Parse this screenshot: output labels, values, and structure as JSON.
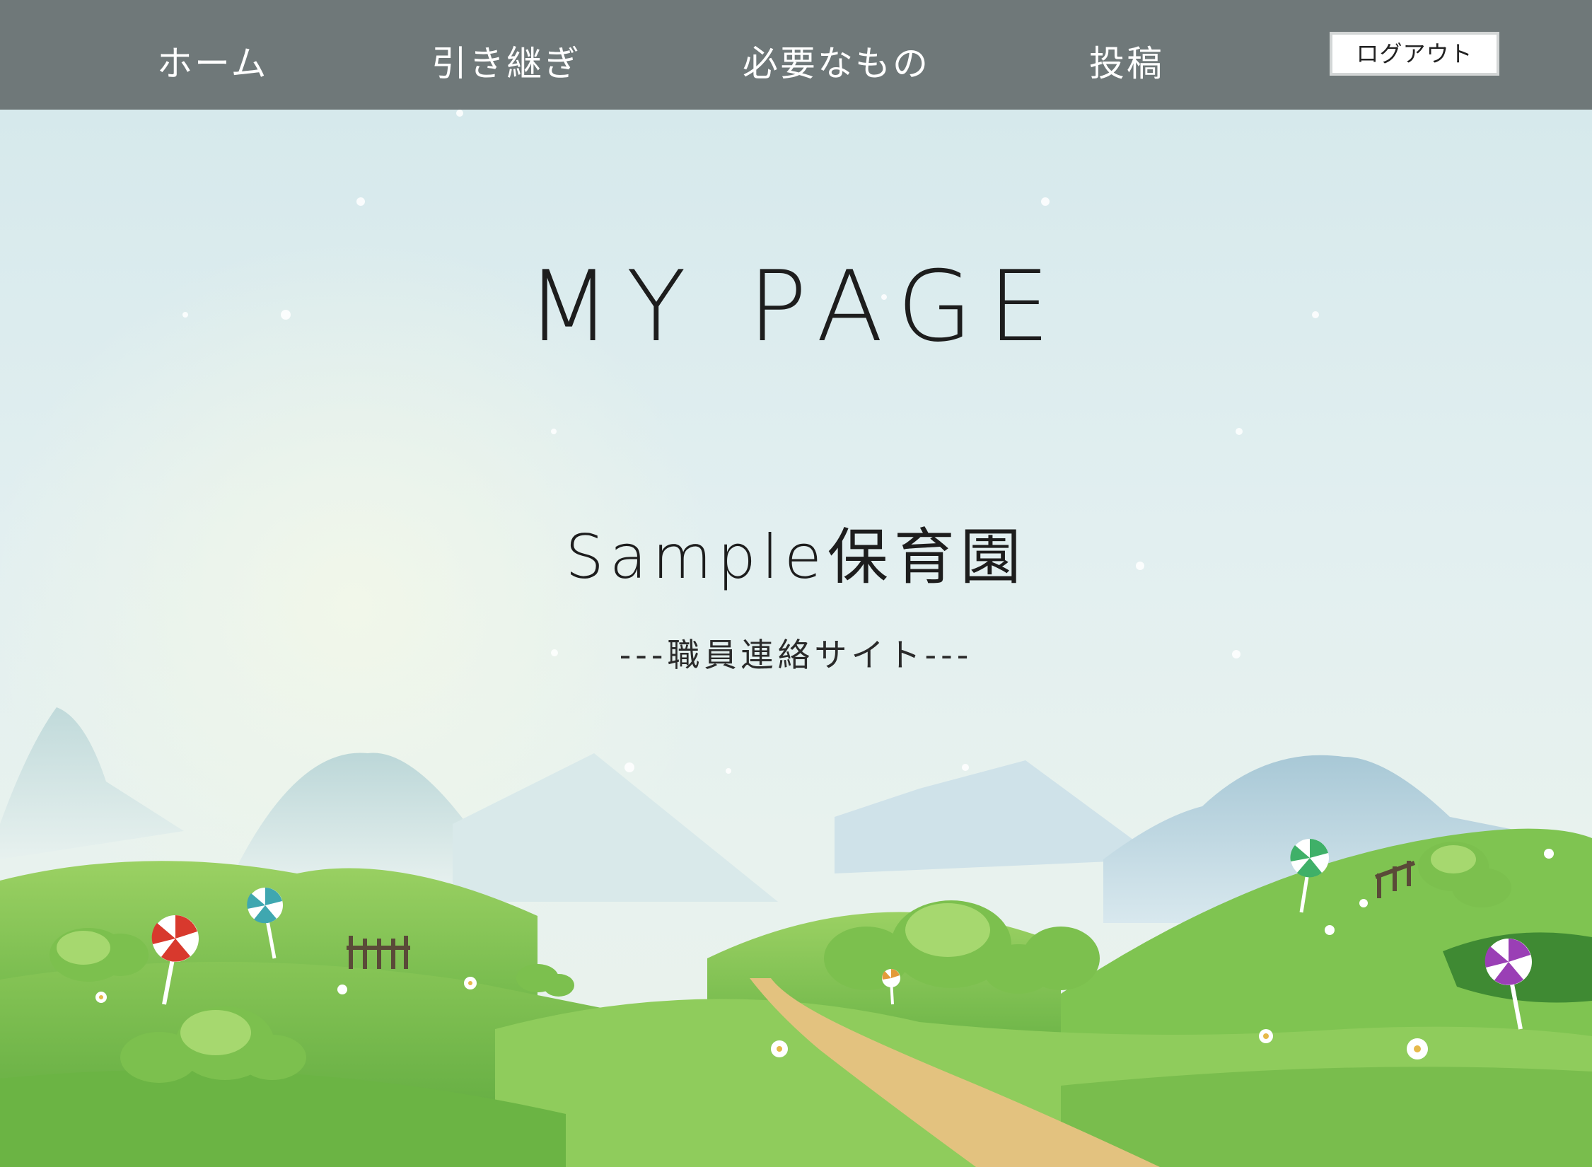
{
  "nav": {
    "items": [
      {
        "label": "ホーム"
      },
      {
        "label": "引き継ぎ"
      },
      {
        "label": "必要なもの"
      },
      {
        "label": "投稿"
      }
    ],
    "logout_label": "ログアウト"
  },
  "hero": {
    "title": "MY PAGE",
    "org_name": "Sample保育園",
    "subtitle": "---職員連絡サイト---"
  },
  "colors": {
    "navbar": "#6f7879",
    "sky": "#d6e9ec",
    "grass": "#7cc04e",
    "path": "#e3c27f"
  }
}
